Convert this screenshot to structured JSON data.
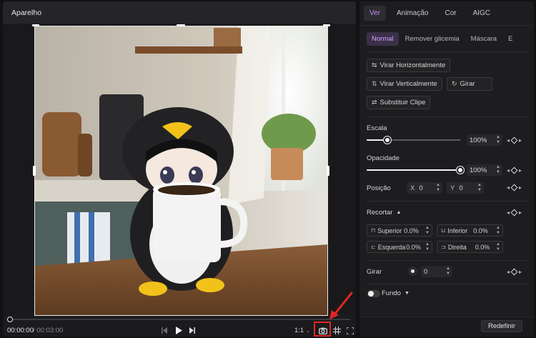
{
  "player": {
    "title": "Aparelho",
    "time_current": "00:00:00",
    "time_total": "/ 00:03:00",
    "ratio": "1:1",
    "progress": 0
  },
  "props": {
    "tabs": [
      {
        "label": "Ver",
        "active": true
      },
      {
        "label": "Animação",
        "active": false
      },
      {
        "label": "Cor",
        "active": false
      },
      {
        "label": "AIGC",
        "active": false
      }
    ],
    "subtabs": [
      {
        "label": "Normal",
        "active": true
      },
      {
        "label": "Remover glicemia",
        "active": false
      },
      {
        "label": "Máscara",
        "active": false
      },
      {
        "label": "E",
        "active": false
      }
    ],
    "buttons": {
      "flip_h": "Virar Horizontalmente",
      "flip_v": "Virar Verticalmente",
      "rotate": "Girar",
      "replace": "Substituir Clipe"
    },
    "scale": {
      "label": "Escala",
      "value": "100%",
      "fraction": 0.1
    },
    "opacity": {
      "label": "Opacidade",
      "value": "100%",
      "fraction": 1.0
    },
    "position": {
      "label": "Posição",
      "x_label": "X",
      "x_value": "0",
      "y_label": "Y",
      "y_value": "0"
    },
    "crop": {
      "label": "Recortar",
      "top_label": "Superior",
      "top_value": "0.0%",
      "bottom_label": "Inferior",
      "bottom_value": "0.0%",
      "left_label": "Esquerda",
      "left_value": "0.0%",
      "right_label": "Direita",
      "right_value": "0.0%"
    },
    "rotate": {
      "label": "Girar",
      "value": "0"
    },
    "background": {
      "label": "Fundo"
    },
    "reset_label": "Redefinir"
  },
  "colors": {
    "accent": "#c58bff",
    "highlight": "#e22626"
  }
}
